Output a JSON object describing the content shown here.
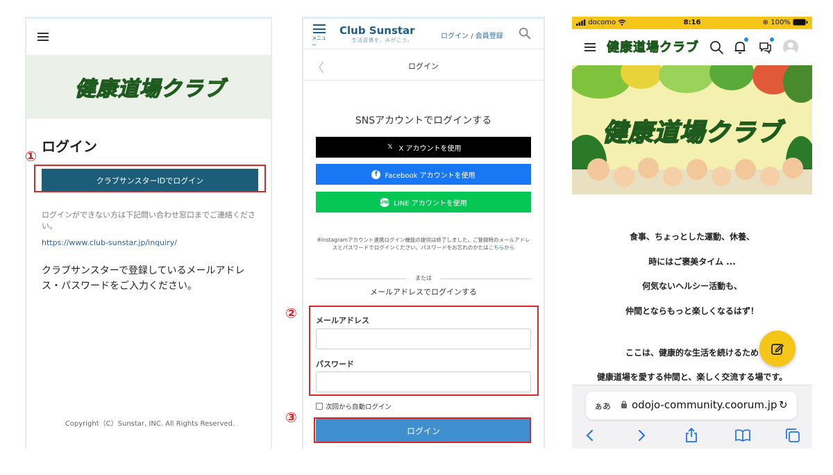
{
  "panel1": {
    "logo_text": "健康道場クラブ",
    "title": "ログイン",
    "step_marker": "①",
    "id_login_button": "クラブサンスターIDでログイン",
    "help_text": "ログインができない方は下記問い合わせ窓口までご連絡ください。",
    "inquiry_link": "https://www.club-sunstar.jp/inquiry/",
    "description": "クラブサンスターで登録しているメールアドレス・パスワードをご入力ください。",
    "copyright": "Copyright（C）Sunstar, INC. All Rights Reserved."
  },
  "panel2": {
    "menu_label": "メニュー",
    "brand_name": "Club Sunstar",
    "brand_tagline": "生活習慣を、みがこう。",
    "header_login_link": "ログイン",
    "header_separator": "/",
    "header_register_link": "会員登録",
    "page_title": "ログイン",
    "sns_heading": "SNSアカウントでログインする",
    "x_button": "X アカウントを使用",
    "facebook_button": "Facebook アカウントを使用",
    "line_button": "LINE アカウントを使用",
    "line_icon_text": "LINE",
    "instagram_note": "※Instagramアカウント連携ログイン機能の提供は終了しました。ご登録時のメールアドレスとパスワードでログインください。パスワードをお忘れのかたは",
    "instagram_note_link": "こちら",
    "instagram_note_end": "から",
    "or_text": "または",
    "email_heading": "メールアドレスでログインする",
    "step2_marker": "②",
    "email_label": "メールアドレス",
    "email_value": "",
    "password_label": "パスワード",
    "password_value": "",
    "auto_login_label": "次回から自動ログイン",
    "auto_login_checked": false,
    "step3_marker": "③",
    "login_button": "ログイン",
    "colors": {
      "brand": "#1c5e8a",
      "x": "#000000",
      "facebook": "#1877f2",
      "line": "#06c755",
      "login": "#3f8fcf",
      "marker": "#d8262a"
    }
  },
  "panel3": {
    "carrier": "docomo",
    "time": "8:16",
    "battery": "100%",
    "nav_logo": "健康道場クラブ",
    "hero_logo": "健康道場クラブ",
    "lines": [
      "食事、ちょっとした運動、休養、",
      "時にはご褒美タイム ...",
      "何気ないヘルシー活動も、",
      "仲間とならもっと楽しくなるはず！",
      "ここは、健康的な生活を続けるため",
      "健康道場を愛する仲間と、楽しく交流する場です。"
    ],
    "safari_text_size": "ぁあ",
    "url": "odojo-community.coorum.jp",
    "icons": [
      "menu-icon",
      "search-icon",
      "bell-icon",
      "chat-icon",
      "avatar",
      "edit-icon",
      "back-icon",
      "forward-icon",
      "share-icon",
      "bookmarks-icon",
      "tabs-icon"
    ],
    "colors": {
      "status_bar": "#f5c518",
      "fab": "#f5c518",
      "badge": "#1e88e5"
    }
  }
}
